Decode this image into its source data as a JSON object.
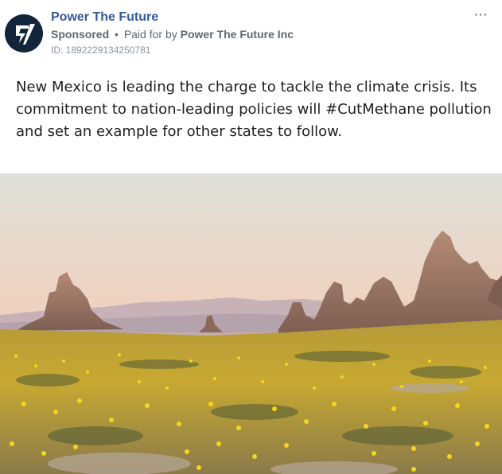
{
  "post": {
    "page_name": "Power The Future",
    "sponsored_label": "Sponsored",
    "separator": "•",
    "paid_for_prefix": "Paid for by",
    "paid_for_by": "Power The Future Inc",
    "ad_id": "ID: 1892229134250781",
    "more_options": "···",
    "body_text": "New Mexico is leading the charge to tackle the climate crisis. Its commitment to nation-leading policies will #CutMethane pollution and set an example for other states to follow."
  },
  "media": {
    "description_icon": "landscape-photo",
    "colors": {
      "sky_top": "#e4ddd2",
      "sky_bottom": "#f2c8a8",
      "rock": "#a57e6c",
      "field": "#c9a93a",
      "flowers": "#f3d21b"
    }
  },
  "avatar": {
    "icon": "lightning-bolt-logo",
    "background": "#13253a"
  }
}
